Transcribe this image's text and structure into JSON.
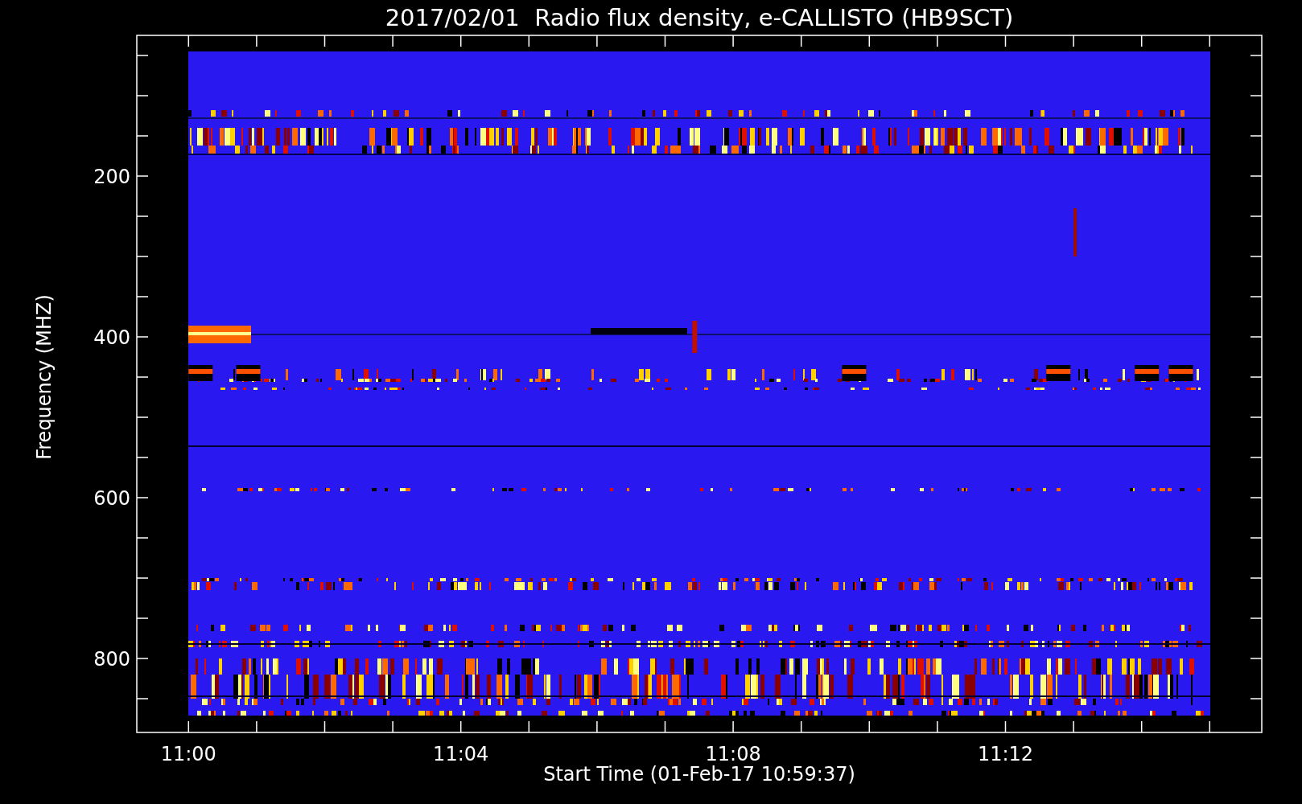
{
  "title": "2017/02/01  Radio flux density, e-CALLISTO (HB9SCT)",
  "y_axis": {
    "label": "Frequency (MHZ)",
    "ticks": [
      "200",
      "400",
      "600",
      "800"
    ]
  },
  "x_axis": {
    "label": "Start Time (01-Feb-17 10:59:37)",
    "ticks": [
      "11:00",
      "11:04",
      "11:08",
      "11:12"
    ]
  }
}
